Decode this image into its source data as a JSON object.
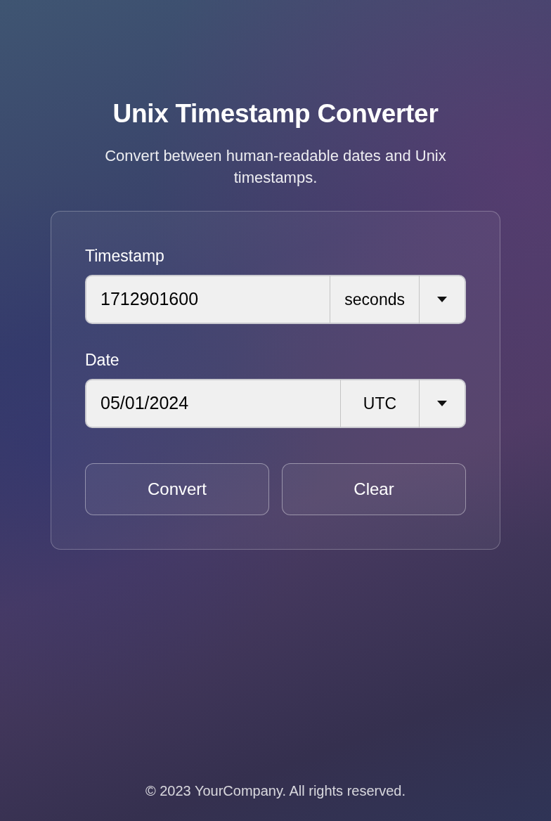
{
  "title": "Unix Timestamp Converter",
  "subtitle": "Convert between human-readable dates and Unix timestamps.",
  "fields": [
    {
      "label": "Timestamp",
      "value": "1712901600",
      "unit": "seconds"
    },
    {
      "label": "Date",
      "value": "05/01/2024",
      "unit": "UTC"
    }
  ],
  "buttons": [
    "Convert",
    "Clear"
  ],
  "footer": "© 2023 YourCompany. All rights reserved."
}
